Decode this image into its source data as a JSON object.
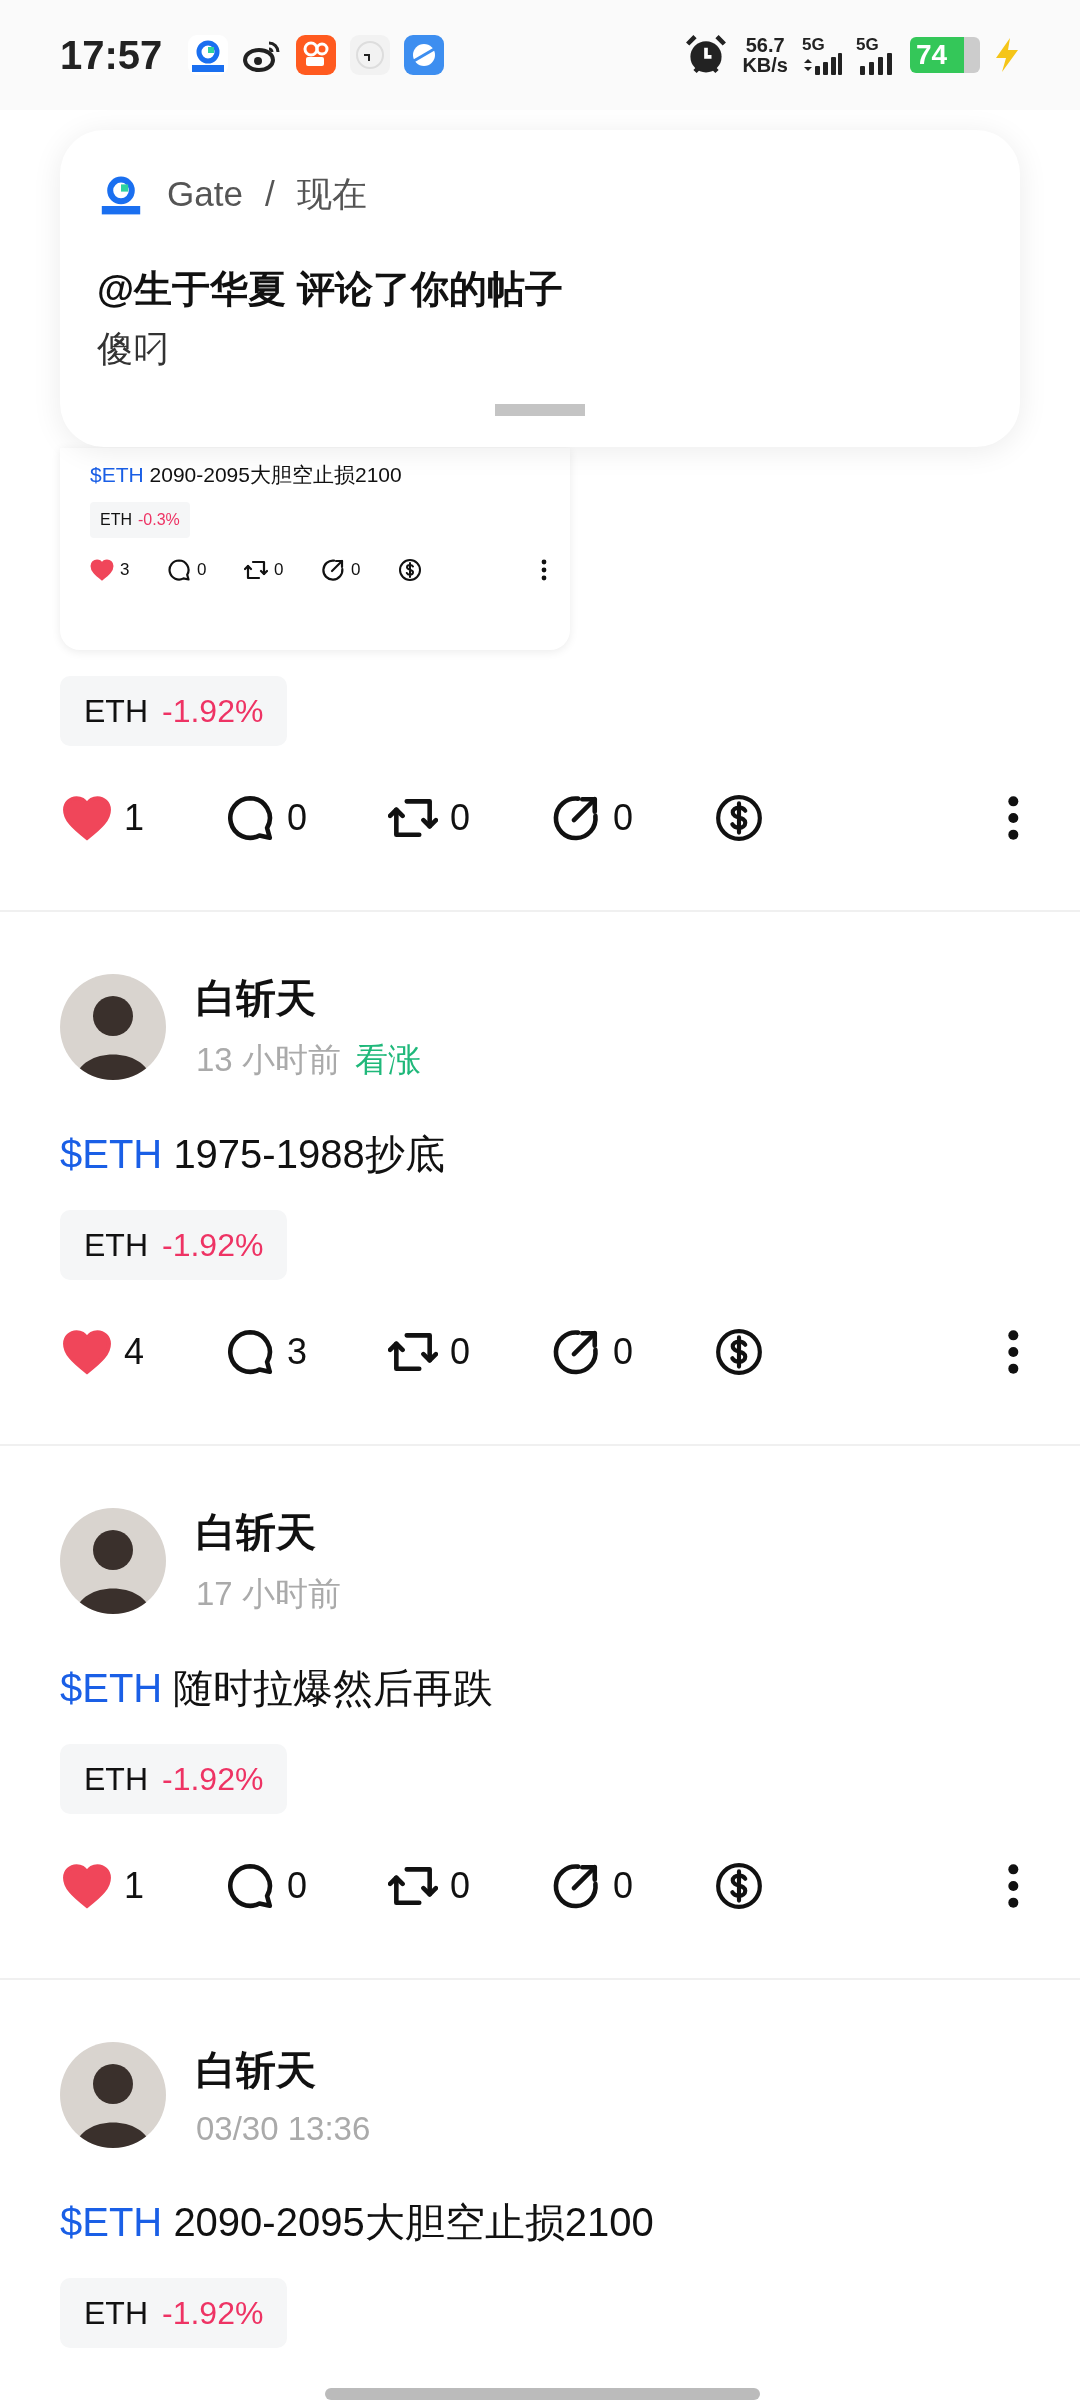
{
  "status_bar": {
    "time": "17:57",
    "network_speed": "56.7",
    "speed_unit": "KB/s",
    "sim_1": "5G",
    "sim_2": "5G",
    "battery": "74"
  },
  "notification": {
    "app": "Gate",
    "separator": "/",
    "when": "现在",
    "title": "@生于华夏 评论了你的帖子",
    "body": "傻叼"
  },
  "floating_card": {
    "ticker": "$ETH",
    "text": "2090-2095大胆空止损2100",
    "tag": {
      "symbol": "ETH",
      "change": "-0.3%"
    },
    "liked": true,
    "likes": "3",
    "comments": "0",
    "reposts": "0",
    "shares": "0"
  },
  "posts": [
    {
      "tag": {
        "symbol": "ETH",
        "change": "-1.92%"
      },
      "liked": true,
      "likes": "1",
      "comments": "0",
      "reposts": "0",
      "shares": "0"
    },
    {
      "author": "白斩天",
      "time": "13 小时前",
      "sentiment": "看涨",
      "ticker": "$ETH",
      "text": "1975-1988抄底",
      "tag": {
        "symbol": "ETH",
        "change": "-1.92%"
      },
      "liked": true,
      "likes": "4",
      "comments": "3",
      "reposts": "0",
      "shares": "0"
    },
    {
      "author": "白斩天",
      "time": "17 小时前",
      "ticker": "$ETH",
      "text": "随时拉爆然后再跌",
      "tag": {
        "symbol": "ETH",
        "change": "-1.92%"
      },
      "liked": true,
      "likes": "1",
      "comments": "0",
      "reposts": "0",
      "shares": "0"
    },
    {
      "author": "白斩天",
      "time": "03/30 13:36",
      "ticker": "$ETH",
      "text": "2090-2095大胆空止损2100",
      "tag": {
        "symbol": "ETH",
        "change": "-1.92%"
      }
    }
  ]
}
